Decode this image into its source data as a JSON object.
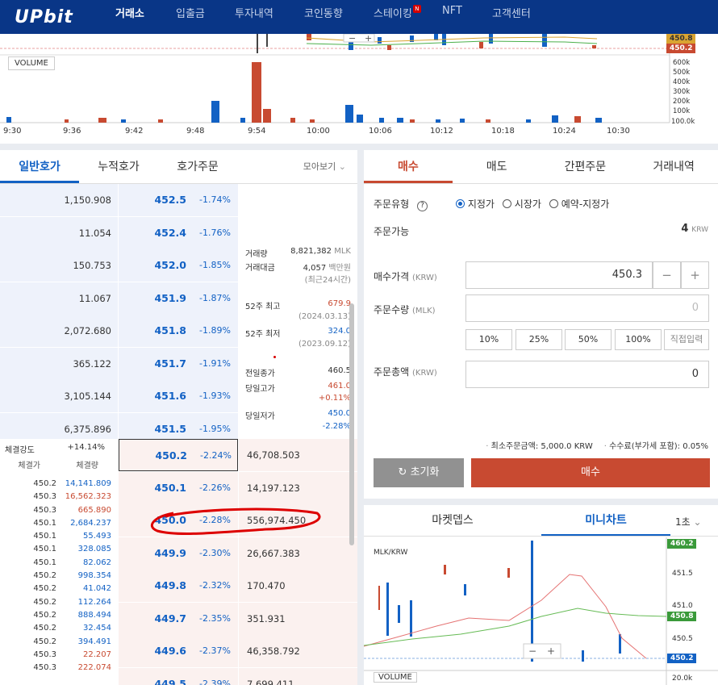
{
  "nav": {
    "logo": "UPbit",
    "items": [
      "거래소",
      "입출금",
      "투자내역",
      "코인동향",
      "스테이킹",
      "NFT",
      "고객센터"
    ],
    "staking_badge": "N"
  },
  "top_chart": {
    "volume_label": "VOLUME",
    "price_tags": [
      "450.8",
      "450.2"
    ],
    "volume_axis": [
      "600k",
      "500k",
      "400k",
      "300k",
      "200k",
      "100k",
      "100.0k"
    ],
    "time_axis": [
      "9:30",
      "9:36",
      "9:42",
      "9:48",
      "9:54",
      "10:00",
      "10:06",
      "10:12",
      "10:18",
      "10:24",
      "10:30"
    ]
  },
  "orderbook": {
    "tabs": [
      "일반호가",
      "누적호가",
      "호가주문"
    ],
    "more_label": "모아보기",
    "sells": [
      {
        "qty": "1,150.908",
        "price": "452.5",
        "change": "-1.74%"
      },
      {
        "qty": "11.054",
        "price": "452.4",
        "change": "-1.76%"
      },
      {
        "qty": "150.753",
        "price": "452.0",
        "change": "-1.85%"
      },
      {
        "qty": "11.067",
        "price": "451.9",
        "change": "-1.87%"
      },
      {
        "qty": "2,072.680",
        "price": "451.8",
        "change": "-1.89%"
      },
      {
        "qty": "365.122",
        "price": "451.7",
        "change": "-1.91%"
      },
      {
        "qty": "3,105.144",
        "price": "451.6",
        "change": "-1.93%"
      },
      {
        "qty": "6,375.896",
        "price": "451.5",
        "change": "-1.95%"
      }
    ],
    "buys": [
      {
        "price": "450.2",
        "change": "-2.24%",
        "qty": "46,708.503"
      },
      {
        "price": "450.1",
        "change": "-2.26%",
        "qty": "14,197.123"
      },
      {
        "price": "450.0",
        "change": "-2.28%",
        "qty": "556,974.450"
      },
      {
        "price": "449.9",
        "change": "-2.30%",
        "qty": "26,667.383"
      },
      {
        "price": "449.8",
        "change": "-2.32%",
        "qty": "170.470"
      },
      {
        "price": "449.7",
        "change": "-2.35%",
        "qty": "351.931"
      },
      {
        "price": "449.6",
        "change": "-2.37%",
        "qty": "46,358.792"
      },
      {
        "price": "449.5",
        "change": "-2.39%",
        "qty": "7,699.411"
      }
    ],
    "info": {
      "volume_label": "거래량",
      "volume_value": "8,821,382",
      "volume_unit": "MLK",
      "amount_label": "거래대금",
      "amount_value": "4,057",
      "amount_unit": "백만원",
      "amount_note": "(최근24시간)",
      "high52_label": "52주 최고",
      "high52_value": "679.9",
      "high52_date": "(2024.03.13)",
      "low52_label": "52주 최저",
      "low52_value": "324.0",
      "low52_date": "(2023.09.12)",
      "prev_label": "전일종가",
      "prev_value": "460.5",
      "dayhigh_label": "당일고가",
      "dayhigh_value": "461.0",
      "dayhigh_pct": "+0.11%",
      "daylow_label": "당일저가",
      "daylow_value": "450.0",
      "daylow_pct": "-2.28%"
    },
    "strength_label": "체결강도",
    "strength_value": "+14.14%",
    "trades_header": [
      "체결가",
      "체결량"
    ],
    "trades": [
      {
        "p": "450.2",
        "q": "14,141.809",
        "side": "blue"
      },
      {
        "p": "450.3",
        "q": "16,562.323",
        "side": "red"
      },
      {
        "p": "450.3",
        "q": "665.890",
        "side": "red"
      },
      {
        "p": "450.1",
        "q": "2,684.237",
        "side": "blue"
      },
      {
        "p": "450.1",
        "q": "55.493",
        "side": "blue"
      },
      {
        "p": "450.1",
        "q": "328.085",
        "side": "blue"
      },
      {
        "p": "450.1",
        "q": "82.062",
        "side": "blue"
      },
      {
        "p": "450.2",
        "q": "998.354",
        "side": "blue"
      },
      {
        "p": "450.2",
        "q": "41.042",
        "side": "blue"
      },
      {
        "p": "450.2",
        "q": "112.264",
        "side": "blue"
      },
      {
        "p": "450.2",
        "q": "888.494",
        "side": "blue"
      },
      {
        "p": "450.2",
        "q": "32.454",
        "side": "blue"
      },
      {
        "p": "450.2",
        "q": "394.491",
        "side": "blue"
      },
      {
        "p": "450.3",
        "q": "22.207",
        "side": "red"
      },
      {
        "p": "450.3",
        "q": "222.074",
        "side": "red"
      }
    ]
  },
  "order": {
    "tabs": [
      "매수",
      "매도",
      "간편주문",
      "거래내역"
    ],
    "type_label": "주문유형",
    "types": [
      "지정가",
      "시장가",
      "예약-지정가"
    ],
    "available_label": "주문가능",
    "available_value": "4",
    "available_unit": "KRW",
    "price_label": "매수가격",
    "price_unit": "(KRW)",
    "price_value": "450.3",
    "qty_label": "주문수량",
    "qty_unit": "(MLK)",
    "qty_value": "0",
    "pcts": [
      "10%",
      "25%",
      "50%",
      "100%",
      "직접입력"
    ],
    "total_label": "주문총액",
    "total_unit": "(KRW)",
    "total_value": "0",
    "min_note": "최소주문금액: 5,000.0 KRW",
    "fee_note": "수수료(부가세 포함): 0.05%",
    "reset_label": "초기화",
    "buy_label": "매수"
  },
  "mini": {
    "tabs": [
      "마켓뎁스",
      "미니차트"
    ],
    "interval": "1초",
    "symbol": "MLK/KRW",
    "price_axis": [
      "451.5",
      "451.0",
      "450.5",
      "20.0k"
    ],
    "tags": [
      "460.2",
      "450.8",
      "450.2"
    ],
    "volume_label": "VOLUME"
  }
}
